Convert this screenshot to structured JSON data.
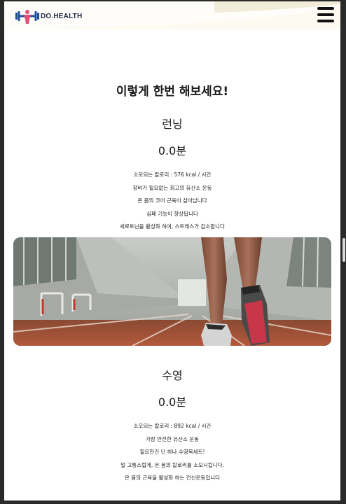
{
  "header": {
    "logo_text": "DO.HEALTH",
    "logo_icon": "dumbbell-person-icon",
    "menu_icon": "hamburger-menu-icon"
  },
  "main": {
    "title": "이렇게 한번 해보세요!"
  },
  "exercises": [
    {
      "name": "런닝",
      "time": "0.0분",
      "desc": [
        "소모되는 칼로리 : 576 kcal / 시간",
        "장비가 필요없는 최고의 유산소 운동",
        "온 몸의 코어 근육이 살아납니다",
        "심폐 기능이 향상됩니다",
        "세로토닌을 활성화 하여, 스트레스가 감소합니다"
      ],
      "image": "running-track-photo"
    },
    {
      "name": "수영",
      "time": "0.0분",
      "desc": [
        "소모되는 칼로리 : 892 kcal / 시간",
        "가장 안전한 유산소 운동",
        "필요한건 단 하나 수영복세트!",
        "덜 고통스럽게, 온 몸의 칼로리를 소모시킵니다.",
        "온 몸의 근육을 활성화 하는 전신운동입니다"
      ]
    }
  ],
  "colors": {
    "header_bg": "#fdfbf1",
    "logo_blue": "#1e4f9a",
    "logo_pink": "#e4507a",
    "text": "#1a1a1a"
  }
}
